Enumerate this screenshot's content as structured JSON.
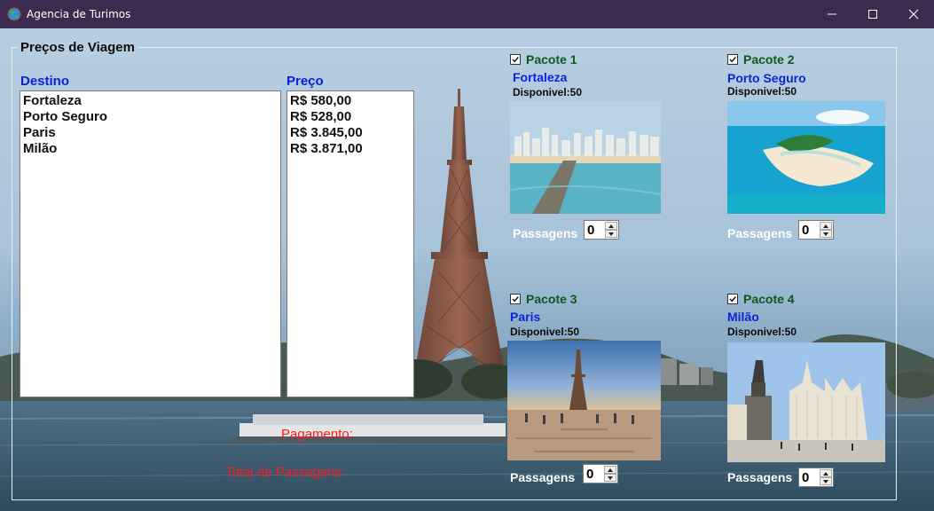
{
  "window": {
    "title": "Agencia de Turimos",
    "icon": "globe-icon",
    "controls": [
      "minimize-icon",
      "maximize-icon",
      "close-icon"
    ]
  },
  "group": {
    "title": "Preços de Viagem"
  },
  "destinos": {
    "label": "Destino",
    "items": [
      "Fortaleza",
      "Porto Seguro",
      "Paris",
      "Milão"
    ]
  },
  "precos": {
    "label": "Preço",
    "items": [
      "R$ 580,00",
      "R$ 528,00",
      "R$ 3.845,00",
      "R$ 3.871,00"
    ]
  },
  "labels": {
    "pagamento": "Pagamento:",
    "total_passagens": "Total de Passagens:"
  },
  "pacotes": [
    {
      "title": "Pacote 1",
      "checked": true,
      "city": "Fortaleza",
      "available": "Disponivel:50",
      "passagens_label": "Passagens",
      "passagens": "0",
      "image": "fortaleza-beach-skyline-photo"
    },
    {
      "title": "Pacote 2",
      "checked": true,
      "city": "Porto Seguro",
      "available": "Disponivel:50",
      "passagens_label": "Passagens",
      "passagens": "0",
      "image": "porto-seguro-island-photo"
    },
    {
      "title": "Pacote 3",
      "checked": true,
      "city": "Paris",
      "available": "Disponivel:50",
      "passagens_label": "Passagens",
      "passagens": "0",
      "image": "paris-eiffel-tower-photo"
    },
    {
      "title": "Pacote 4",
      "checked": true,
      "city": "Milão",
      "available": "Disponivel:50",
      "passagens_label": "Passagens",
      "passagens": "0",
      "image": "milan-cathedral-photo"
    }
  ],
  "colors": {
    "title_bar": "#3b2b4f",
    "destino_label": "#0c1fd6",
    "pacote_title": "#0b5a1c",
    "warning_text": "#ff1a1a"
  }
}
